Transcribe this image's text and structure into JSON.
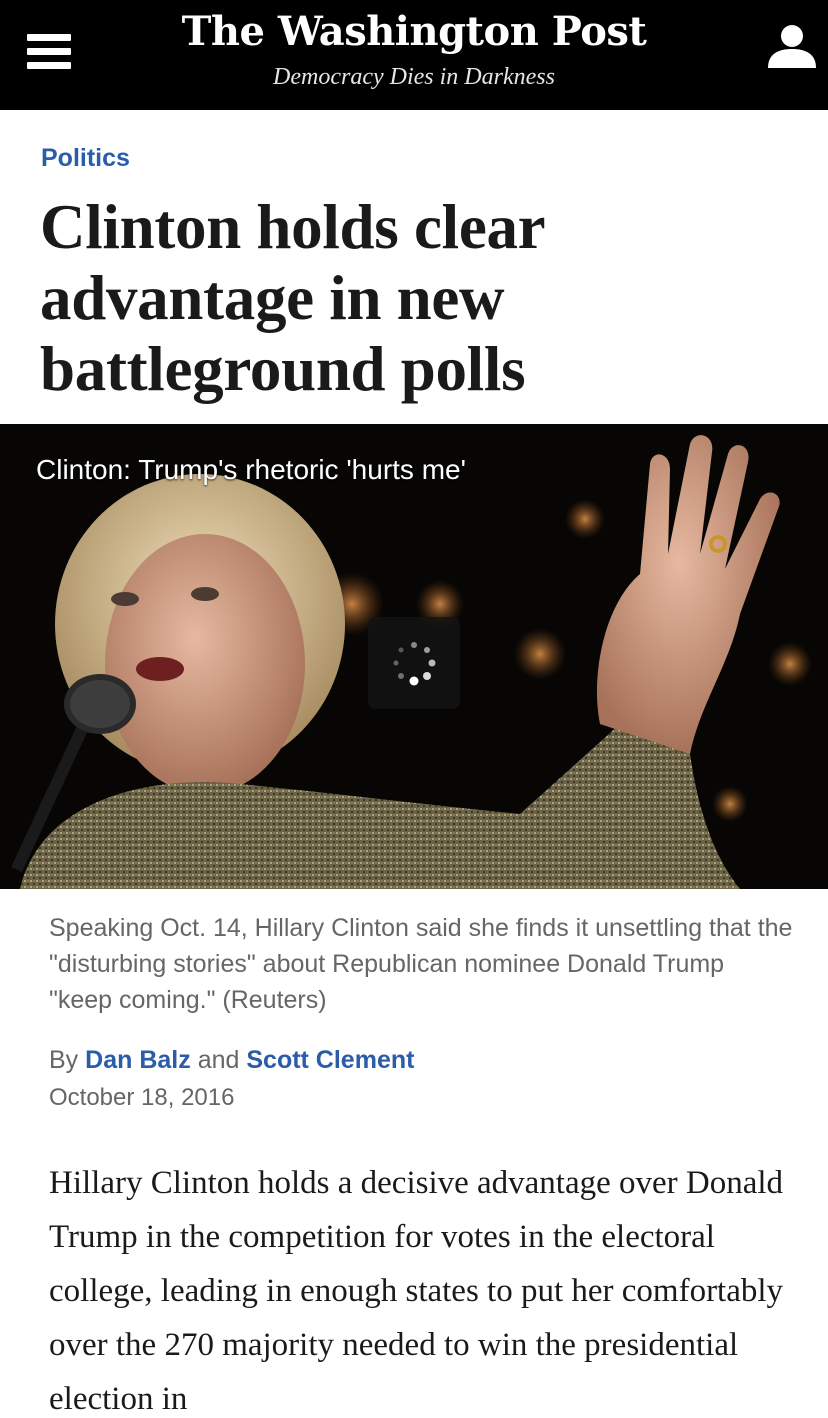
{
  "header": {
    "masthead": "The Washington Post",
    "tagline": "Democracy Dies in Darkness",
    "menu_icon": "hamburger-menu-icon",
    "user_icon": "user-account-icon",
    "background": "#000000"
  },
  "article": {
    "section": "Politics",
    "headline": "Clinton holds clear advantage in new battleground polls",
    "video": {
      "title": "Clinton: Trump's rhetoric 'hurts me'",
      "state_icon": "loading-spinner-icon"
    },
    "caption": "Speaking Oct. 14, Hillary Clinton said she finds it unsettling that the \"disturbing stories\" about Republican nominee Donald Trump \"keep coming.\" (Reuters)",
    "byline": {
      "prefix": "By",
      "author1": "Dan Balz",
      "joiner": "and",
      "author2": "Scott Clement"
    },
    "date": "October 18, 2016",
    "body": "Hillary Clinton holds a decisive advantage over Donald Trump in the competition for votes in the electoral college, leading in enough states to put her comfortably over the 270 majority needed to win the presidential election in"
  },
  "colors": {
    "link": "#2a5caa",
    "meta_text": "#666666",
    "headline_text": "#1a1a1a"
  }
}
